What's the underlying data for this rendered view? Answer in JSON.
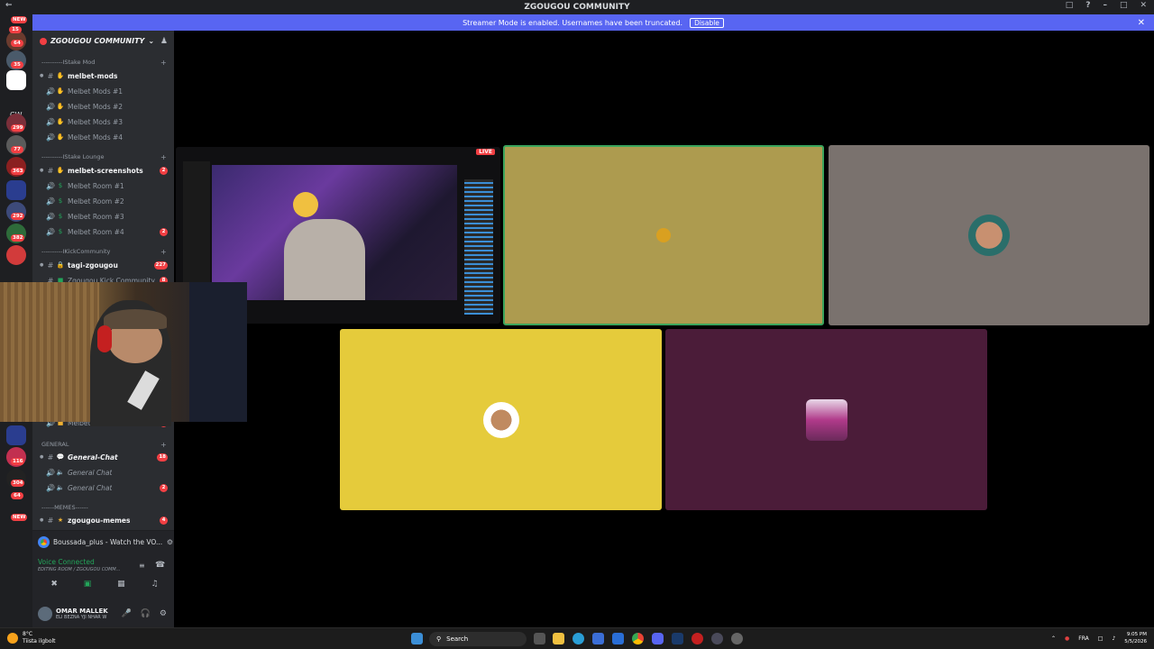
{
  "window": {
    "title": "ZGOUGOU COMMUNITY"
  },
  "banner": {
    "text": "Streamer Mode is enabled. Usernames have been truncated.",
    "button": "Disable"
  },
  "guild_badges": [
    "15",
    "64",
    "35",
    "299",
    "77",
    "363",
    "292",
    "382",
    "116",
    "304",
    "64"
  ],
  "guild_labels": {
    "cw": "CW",
    "new_top": "NEW",
    "new_bottom": "NEW"
  },
  "server": {
    "name": "ZGOUGOU COMMUNITY"
  },
  "categories": {
    "stake_mod": "----------IStake Mod",
    "stake_lounge": "----------IStake Lounge",
    "kick_community": "----------IKickCommunity",
    "general": "GENERAL",
    "memes": "------MEMES------"
  },
  "channels": [
    {
      "label": "melbet-mods",
      "type": "text",
      "unread": true,
      "badge": ""
    },
    {
      "label": "Melbet Mods #1",
      "type": "voice",
      "unread": false,
      "badge": ""
    },
    {
      "label": "Melbet Mods #2",
      "type": "voice",
      "unread": false,
      "badge": ""
    },
    {
      "label": "Melbet Mods #3",
      "type": "voice",
      "unread": false,
      "badge": ""
    },
    {
      "label": "Melbet Mods #4",
      "type": "voice",
      "unread": false,
      "badge": ""
    },
    {
      "label": "melbet-screenshots",
      "type": "text",
      "unread": true,
      "badge": "2"
    },
    {
      "label": "Melbet Room #1",
      "type": "voice",
      "unread": false,
      "badge": ""
    },
    {
      "label": "Melbet Room #2",
      "type": "voice",
      "unread": false,
      "badge": ""
    },
    {
      "label": "Melbet Room #3",
      "type": "voice",
      "unread": false,
      "badge": ""
    },
    {
      "label": "Melbet Room #4",
      "type": "voice",
      "unread": false,
      "badge": "2"
    },
    {
      "label": "tagi-zgougou",
      "type": "text",
      "unread": true,
      "badge": "227"
    },
    {
      "label": "Zgougou Kick Community",
      "type": "text",
      "unread": false,
      "badge": "8"
    },
    {
      "label": "Melbet",
      "type": "voice",
      "unread": false,
      "badge": "1"
    },
    {
      "label": "General-Chat",
      "type": "text",
      "unread": true,
      "badge": "18"
    },
    {
      "label": "General Chat",
      "type": "voice",
      "unread": false,
      "badge": ""
    },
    {
      "label": "General Chat",
      "type": "voice",
      "unread": false,
      "badge": "2"
    },
    {
      "label": "zgougou-memes",
      "type": "text",
      "unread": true,
      "badge": "4"
    }
  ],
  "activity": {
    "text": "Boussada_plus - Watch the VO..."
  },
  "voice": {
    "status": "Voice Connected",
    "room": "EDITING ROOM / ZGOUGOU COMM..."
  },
  "user": {
    "name": "OMAR MALLEK",
    "status": "ELI BEZNA YJI NHAR W"
  },
  "stream": {
    "live_label": "LIVE"
  },
  "tiles": [
    {
      "bg": "#ad9b4f",
      "border": "#3ba55c"
    },
    {
      "bg": "#7a726e",
      "border": ""
    },
    {
      "bg": "#e5cb3b",
      "border": ""
    },
    {
      "bg": "#4b1c39",
      "border": ""
    }
  ],
  "taskbar": {
    "weather_temp": "8°C",
    "weather_desc": "Tiista ilgbolt",
    "search": "Search",
    "lang": "FRA",
    "time": "9:05 PM",
    "date": "5/5/2026"
  },
  "colors": {
    "accent": "#5865f2",
    "online": "#23a55a",
    "badge": "#f23f43"
  }
}
